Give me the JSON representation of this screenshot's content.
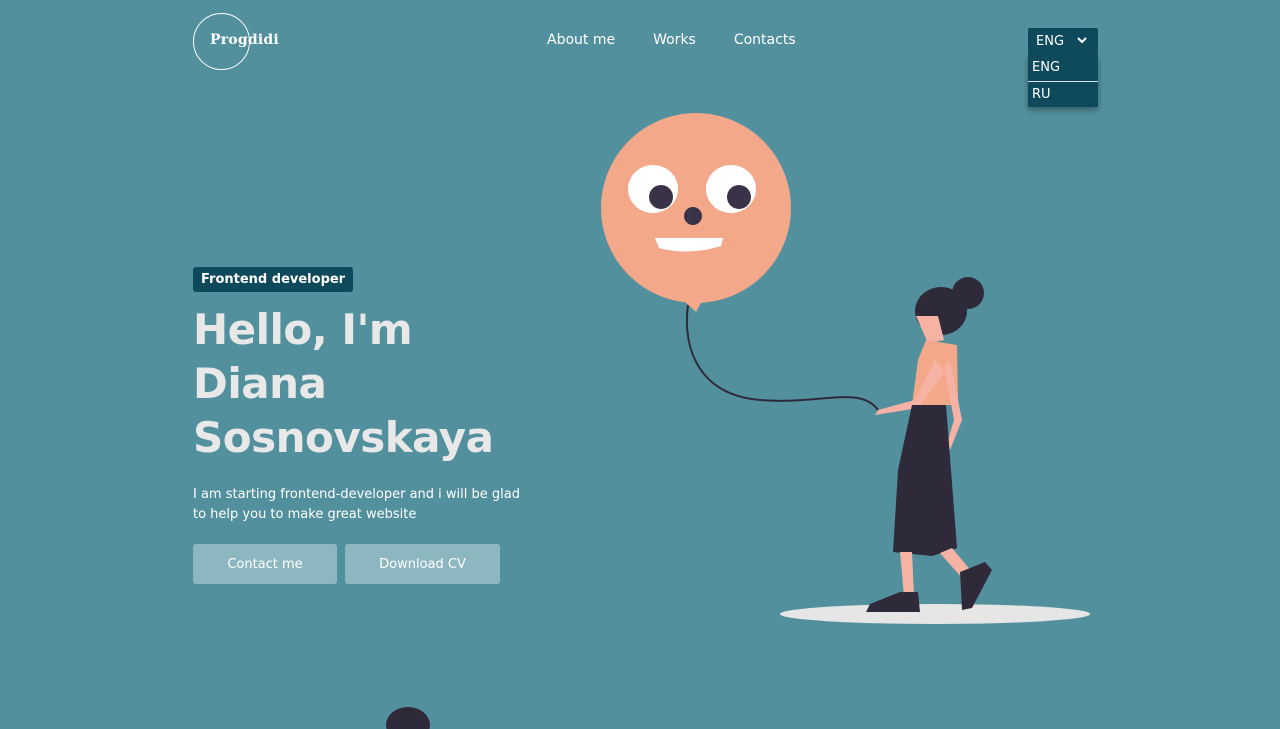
{
  "header": {
    "logo_text": "Progdidi",
    "nav": [
      {
        "label": "About me"
      },
      {
        "label": "Works"
      },
      {
        "label": "Contacts"
      }
    ],
    "language": {
      "selected": "ENG",
      "options": [
        "ENG",
        "RU"
      ]
    }
  },
  "hero": {
    "badge": "Frontend developer",
    "headline": "Hello, I'm Diana Sosnovskaya",
    "intro": "I am starting frontend-developer and i will be glad to help you to make great website",
    "buttons": {
      "contact": "Contact me",
      "download": "Download CV"
    }
  },
  "colors": {
    "background": "#53909e",
    "dark_accent": "#0f4a5c",
    "button": "#8db7c0",
    "balloon": "#f4a88a"
  },
  "icons": {
    "dropdown": "chevron-down-icon"
  }
}
